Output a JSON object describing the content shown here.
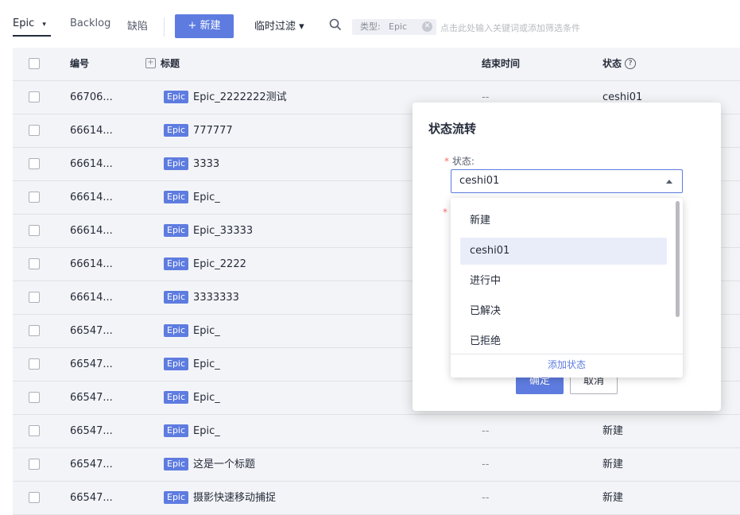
{
  "toolbar": {
    "tabs": [
      {
        "label": "Epic"
      },
      {
        "label": "Backlog"
      },
      {
        "label": "缺陷"
      }
    ],
    "new_button": "+ 新建",
    "filter_dropdown": "临时过滤 ▾",
    "chip_key": "类型:",
    "chip_value": "Epic",
    "search_placeholder": "点击此处输入关键词或添加筛选条件"
  },
  "table": {
    "headers": {
      "id": "编号",
      "title": "标题",
      "end_time": "结束时间",
      "status": "状态"
    },
    "tag_label": "Epic",
    "rows": [
      {
        "id": "66706...",
        "title": "Epic_2222222测试",
        "end": "--",
        "status": "ceshi01"
      },
      {
        "id": "66614...",
        "title": "777777",
        "end": "",
        "status": ""
      },
      {
        "id": "66614...",
        "title": "3333",
        "end": "",
        "status": ""
      },
      {
        "id": "66614...",
        "title": "Epic_",
        "end": "",
        "status": ""
      },
      {
        "id": "66614...",
        "title": "Epic_33333",
        "end": "",
        "status": ""
      },
      {
        "id": "66614...",
        "title": "Epic_2222",
        "end": "",
        "status": ""
      },
      {
        "id": "66614...",
        "title": "3333333",
        "end": "",
        "status": ""
      },
      {
        "id": "66547...",
        "title": "Epic_",
        "end": "",
        "status": ""
      },
      {
        "id": "66547...",
        "title": "Epic_",
        "end": "",
        "status": ""
      },
      {
        "id": "66547...",
        "title": "Epic_",
        "end": "",
        "status": ""
      },
      {
        "id": "66547...",
        "title": "Epic_",
        "end": "--",
        "status": "新建"
      },
      {
        "id": "66547...",
        "title": "这是一个标题",
        "end": "--",
        "status": "新建"
      },
      {
        "id": "66547...",
        "title": "摄影快速移动捕捉",
        "end": "--",
        "status": "新建"
      }
    ]
  },
  "modal": {
    "title": "状态流转",
    "status_label": "状态:",
    "selected_value": "ceshi01",
    "ok_label": "确定",
    "cancel_label": "取消"
  },
  "dropdown": {
    "options": [
      "新建",
      "ceshi01",
      "进行中",
      "已解决",
      "已拒绝"
    ],
    "selected_index": 1,
    "footer": "添加状态"
  },
  "colors": {
    "accent": "#5e7ce0",
    "required": "#f66f6a",
    "row_bg": "#f3f4f7"
  }
}
